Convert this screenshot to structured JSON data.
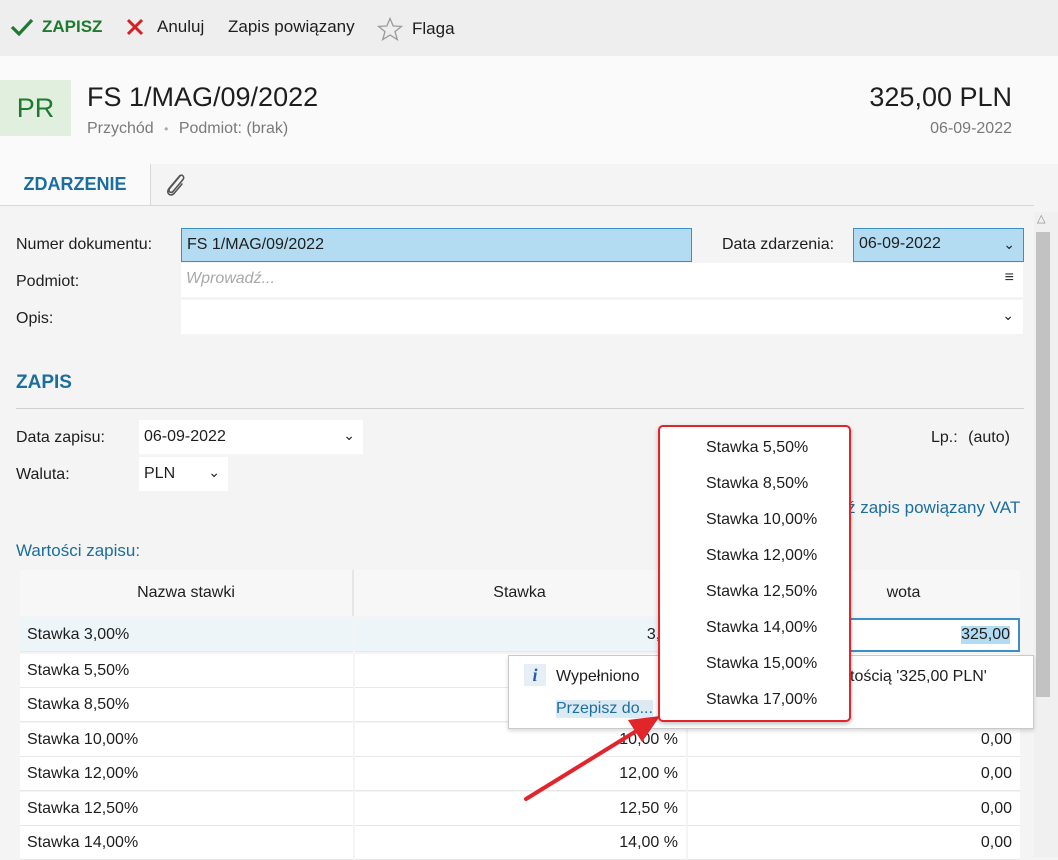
{
  "toolbar": {
    "save_label": "ZAPISZ",
    "cancel_label": "Anuluj",
    "related_label": "Zapis powiązany",
    "flag_label": "Flaga"
  },
  "header": {
    "badge": "PR",
    "title": "FS 1/MAG/09/2022",
    "type": "Przychód",
    "separator": "•",
    "subject": "Podmiot: (brak)",
    "amount": "325,00 PLN",
    "date": "06-09-2022"
  },
  "tabs": {
    "active_label": "ZDARZENIE",
    "attachment_icon": "paperclip-icon"
  },
  "form": {
    "doc_number_label": "Numer dokumentu:",
    "doc_number_value": "FS 1/MAG/09/2022",
    "event_date_label": "Data zdarzenia:",
    "event_date_value": "06-09-2022",
    "subject_label": "Podmiot:",
    "subject_placeholder": "Wprowadź...",
    "description_label": "Opis:"
  },
  "zapis": {
    "section_title": "ZAPIS",
    "date_label": "Data zapisu:",
    "date_value": "06-09-2022",
    "currency_label": "Waluta:",
    "currency_value": "PLN",
    "lp_label": "Lp.:",
    "lp_value": "(auto)",
    "vat_link_tail": "ź zapis powiązany VAT",
    "values_title": "Wartości zapisu:"
  },
  "table": {
    "headers": [
      "Nazwa stawki",
      "Stawka",
      "wota"
    ],
    "rows": [
      {
        "name": "Stawka 3,00%",
        "rate": "3,00",
        "amount": "325,00"
      },
      {
        "name": "Stawka 5,50%",
        "rate": "",
        "amount": ""
      },
      {
        "name": "Stawka 8,50%",
        "rate": "",
        "amount": ""
      },
      {
        "name": "Stawka 10,00%",
        "rate": "10,00 %",
        "amount": "0,00"
      },
      {
        "name": "Stawka 12,00%",
        "rate": "12,00 %",
        "amount": "0,00"
      },
      {
        "name": "Stawka 12,50%",
        "rate": "12,50 %",
        "amount": "0,00"
      },
      {
        "name": "Stawka 14,00%",
        "rate": "14,00 %",
        "amount": "0,00"
      }
    ]
  },
  "info_popup": {
    "icon": "info-icon",
    "text_left": "Wypełniono",
    "text_right": "tością '325,00 PLN'",
    "link": "Przepisz do..."
  },
  "dropdown": {
    "items": [
      "Stawka 5,50%",
      "Stawka 8,50%",
      "Stawka 10,00%",
      "Stawka 12,00%",
      "Stawka 12,50%",
      "Stawka 14,00%",
      "Stawka 15,00%",
      "Stawka 17,00%"
    ]
  },
  "colors": {
    "accent": "#1b6e9e",
    "save_green": "#1f7a2f",
    "highlight_red": "#e2242b",
    "selection": "#b3dcf2"
  }
}
